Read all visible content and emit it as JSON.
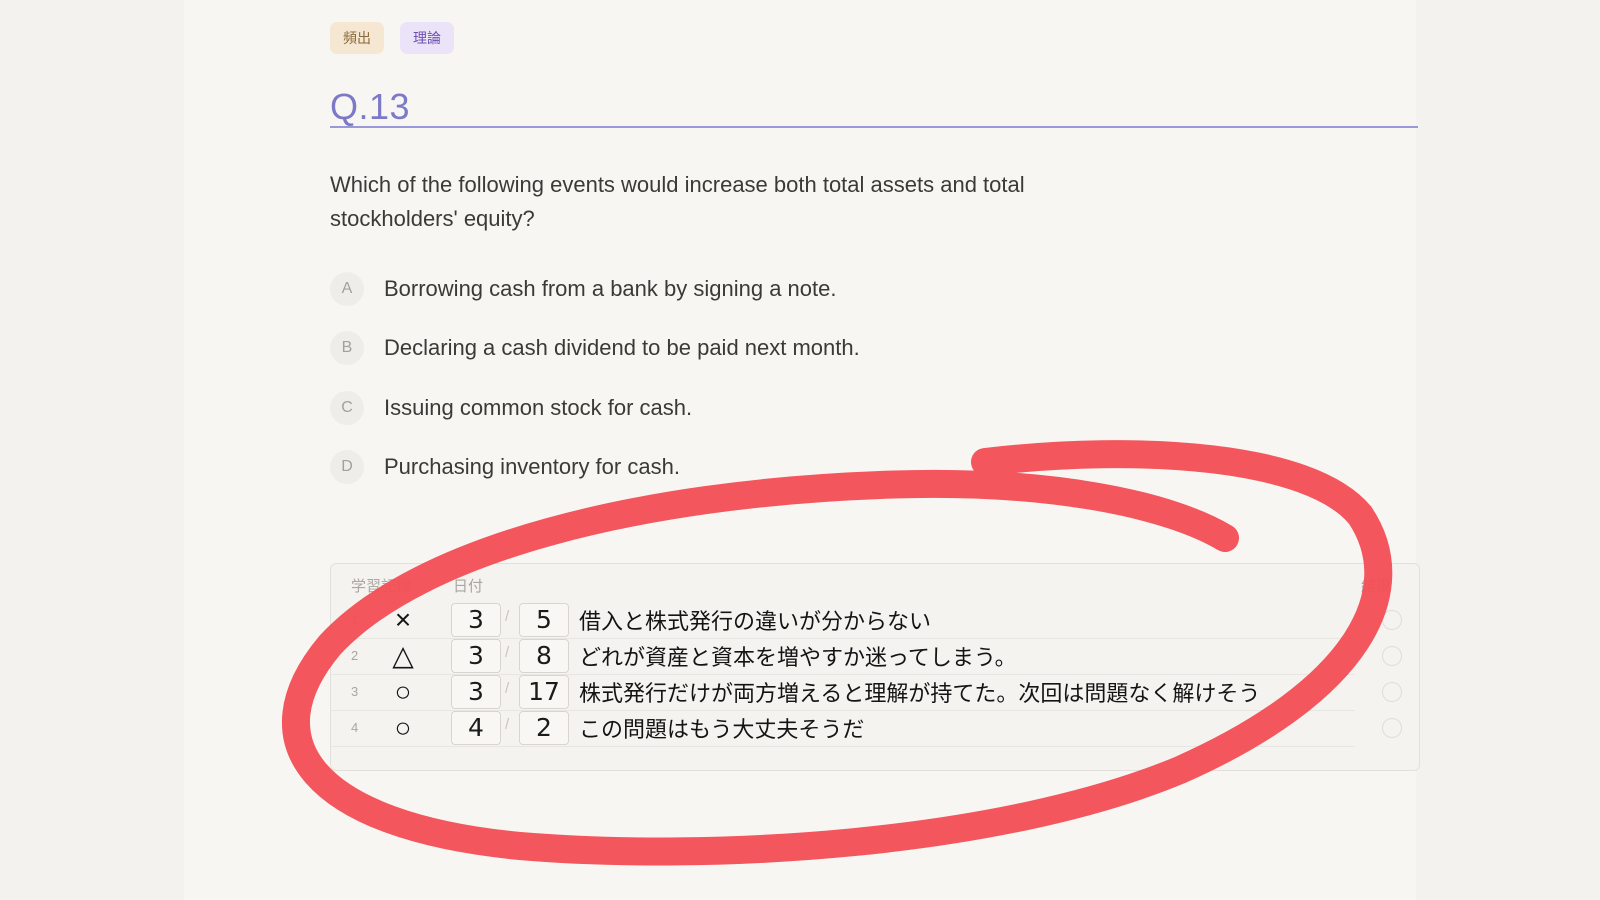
{
  "tags": [
    {
      "label": "頻出"
    },
    {
      "label": "理論"
    }
  ],
  "question": {
    "number": "Q.13",
    "text": "Which of the following events would increase both total assets and total stockholders' equity?"
  },
  "options": [
    {
      "letter": "A",
      "text": "Borrowing cash from a bank by signing a note."
    },
    {
      "letter": "B",
      "text": "Declaring a cash dividend to be paid next month."
    },
    {
      "letter": "C",
      "text": "Issuing common stock for cash."
    },
    {
      "letter": "D",
      "text": "Purchasing inventory for cash."
    }
  ],
  "study_record": {
    "header_record": "学習記録",
    "header_date": "日付",
    "header_result": "結果",
    "rows": [
      {
        "index": "1",
        "mark": "×",
        "month": "3",
        "day": "5",
        "note": "借入と株式発行の違いが分からない"
      },
      {
        "index": "2",
        "mark": "△",
        "month": "3",
        "day": "8",
        "note": "どれが資産と資本を増やすか迷ってしまう。"
      },
      {
        "index": "3",
        "mark": "○",
        "month": "3",
        "day": "17",
        "note": "株式発行だけが両方増えると理解が持てた。次回は問題なく解けそう"
      },
      {
        "index": "4",
        "mark": "○",
        "month": "4",
        "day": "2",
        "note": "この問題はもう大丈夫そうだ"
      }
    ]
  },
  "colors": {
    "accent": "#7d79c9",
    "annotation": "#f24f55"
  }
}
